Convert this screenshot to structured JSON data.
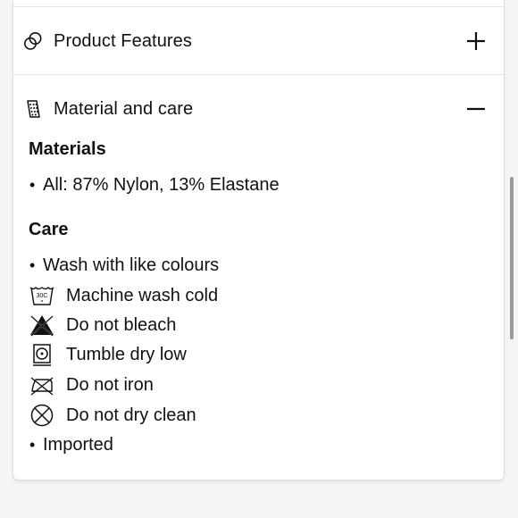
{
  "accordion": {
    "product_features": {
      "title": "Product Features",
      "icon": "overlapping-circles-icon",
      "toggle": "plus-icon"
    },
    "material_care": {
      "title": "Material and care",
      "icon": "fabric-tag-icon",
      "toggle": "minus-icon",
      "materials_heading": "Materials",
      "materials": [
        "All: 87% Nylon, 13% Elastane"
      ],
      "care_heading": "Care",
      "care": [
        {
          "text": "Wash with like colours",
          "marker": "bullet"
        },
        {
          "text": "Machine wash cold",
          "marker": "wash-30c-icon",
          "icon_text": "30C"
        },
        {
          "text": "Do not bleach",
          "marker": "no-bleach-icon"
        },
        {
          "text": "Tumble dry low",
          "marker": "tumble-dry-low-icon"
        },
        {
          "text": "Do not iron",
          "marker": "no-iron-icon"
        },
        {
          "text": "Do not dry clean",
          "marker": "no-dry-clean-icon"
        },
        {
          "text": "Imported",
          "marker": "bullet"
        }
      ]
    }
  },
  "colors": {
    "background": "#f5f5f5",
    "card": "#ffffff",
    "divider": "#e2e2e2",
    "text": "#111111"
  },
  "bullet_char": "•"
}
